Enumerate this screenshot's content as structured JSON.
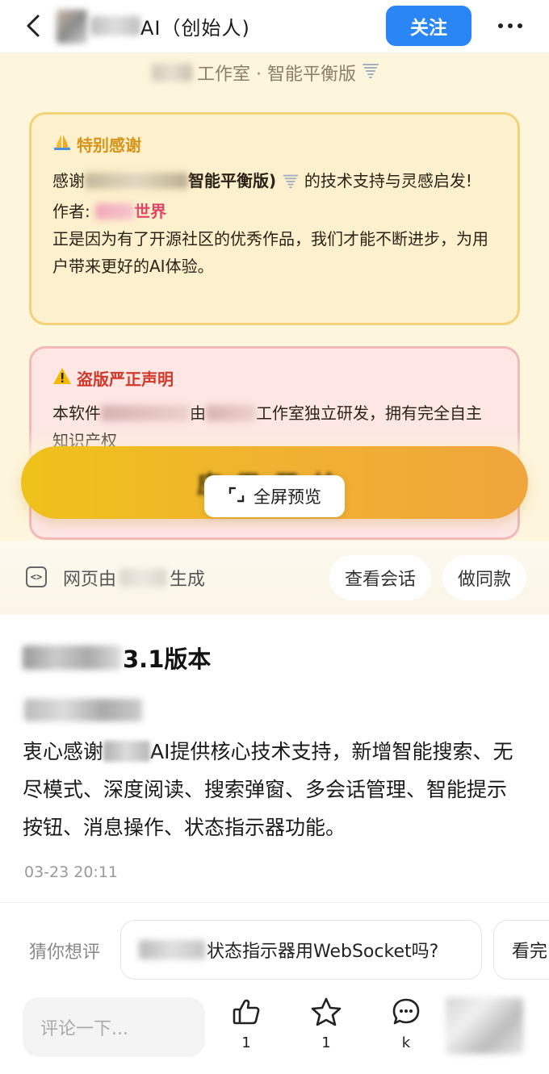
{
  "topbar": {
    "title": "AI（创始人)",
    "follow_label": "关注"
  },
  "preview": {
    "studio_text": "工作室 · 智能平衡版",
    "thanks_card": {
      "title": "特别感谢",
      "line1_prefix": "感谢",
      "line1_bold": "智能平衡版)",
      "line1_suffix": "的技术支持与灵感启发!",
      "author_label": "作者:",
      "author_name": "世界",
      "closing": "正是因为有了开源社区的优秀作品，我们才能不断进步，为用户带来更好的AI体验。"
    },
    "warn_card": {
      "title": "盗版严正声明",
      "body_prefix": "本软件",
      "body_mid": "由",
      "body_suffix": "工作室独立研发，拥有完全自主知识产权"
    },
    "fullscreen_label": "全屏预览"
  },
  "infobar": {
    "gen_prefix": "网页由",
    "gen_suffix": "生成",
    "view_session_label": "查看会话",
    "make_same_label": "做同款"
  },
  "post": {
    "title_suffix": "3.1版本",
    "body_prefix": "衷心感谢",
    "body_rest": "AI提供核心技术支持，新增智能搜索、无尽模式、深度阅读、搜索弹窗、多会话管理、智能提示按钮、消息操作、状态指示器功能。",
    "timestamp": "03-23 20:11"
  },
  "guess": {
    "label": "猜你想评",
    "chip1_suffix": "状态指示器用WebSocket吗?",
    "chip2": "看完"
  },
  "bottombar": {
    "comment_placeholder": "评论一下...",
    "like_count": "1",
    "star_count": "1",
    "comment_count": "k"
  },
  "colors": {
    "accent_blue": "#2a86f5",
    "preview_bg": "#fdf5dc",
    "thanks_border": "#f3d27a",
    "warn_border": "#f3b8b8",
    "button_gold": "#efc21a"
  },
  "icons": [
    "back-icon",
    "more-icon",
    "tornado-icon",
    "pray-icon",
    "warning-icon",
    "expand-icon",
    "code-icon",
    "thumbs-up-icon",
    "star-icon",
    "comment-icon"
  ]
}
